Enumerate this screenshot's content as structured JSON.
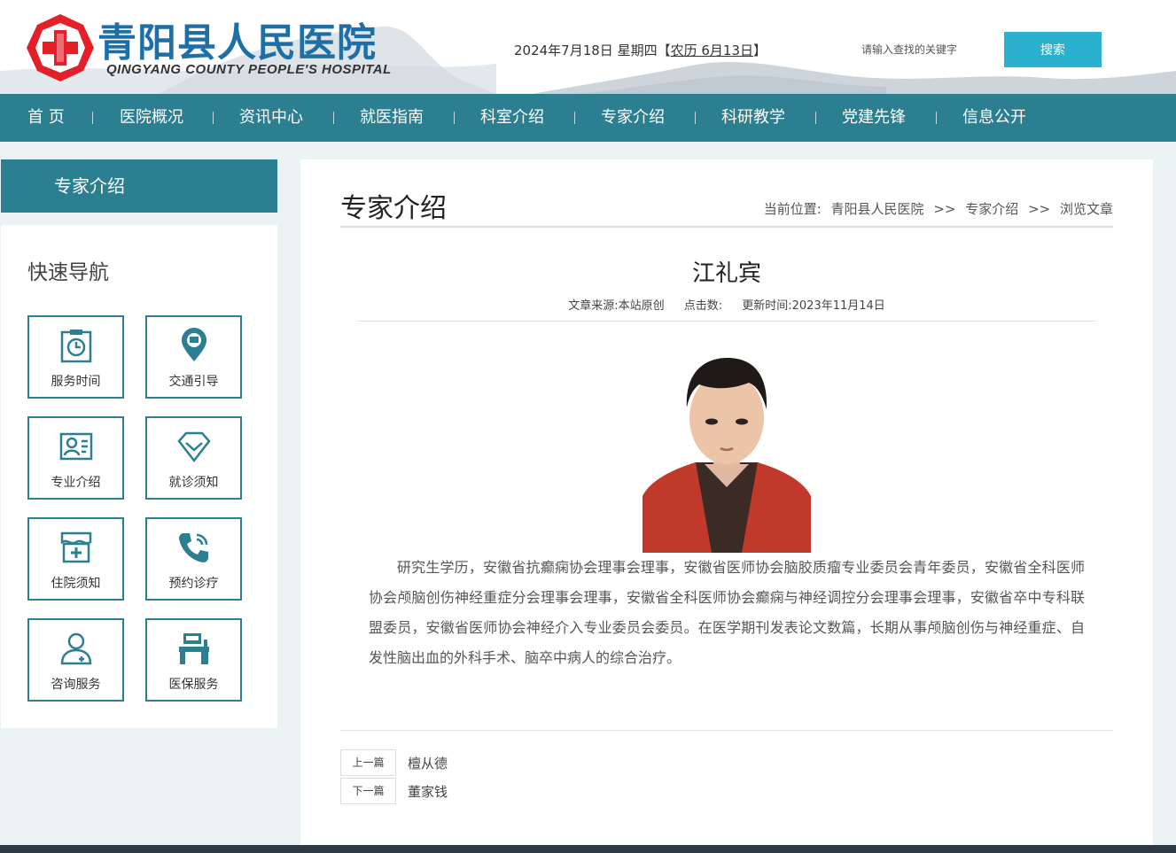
{
  "header": {
    "logo_cn": "青阳县人民医院",
    "logo_en": "QINGYANG COUNTY PEOPLE'S HOSPITAL",
    "date": "2024年7月18日 星期四",
    "lunar_open": "【",
    "lunar": "农历 6月13日",
    "lunar_close": "】",
    "search_placeholder": "请输入查找的关键字",
    "search_button": "搜索"
  },
  "nav": [
    {
      "label": "首 页"
    },
    {
      "label": "医院概况"
    },
    {
      "label": "资讯中心"
    },
    {
      "label": "就医指南"
    },
    {
      "label": "科室介绍"
    },
    {
      "label": "专家介绍"
    },
    {
      "label": "科研教学"
    },
    {
      "label": "党建先锋"
    },
    {
      "label": "信息公开"
    }
  ],
  "sidebar": {
    "title": "专家介绍",
    "quick_title": "快速导航",
    "items": [
      {
        "label": "服务时间",
        "icon": "clock-clipboard-icon"
      },
      {
        "label": "交通引导",
        "icon": "location-bus-icon"
      },
      {
        "label": "专业介绍",
        "icon": "profile-card-icon"
      },
      {
        "label": "就诊须知",
        "icon": "diamond-check-icon"
      },
      {
        "label": "住院须知",
        "icon": "hospital-bed-icon"
      },
      {
        "label": "预约诊疗",
        "icon": "phone-icon"
      },
      {
        "label": "咨询服务",
        "icon": "doctor-icon"
      },
      {
        "label": "医保服务",
        "icon": "desk-icon"
      }
    ]
  },
  "main": {
    "title": "专家介绍",
    "breadcrumb_label": "当前位置:",
    "breadcrumb": [
      "青阳县人民医院",
      ">>",
      "专家介绍",
      ">>",
      "浏览文章"
    ],
    "article_title": "江礼宾",
    "meta": {
      "source": "文章来源:本站原创",
      "clicks": "点击数:",
      "updated": "更新时间:2023年11月14日"
    },
    "body": "研究生学历，安徽省抗癫痫协会理事会理事，安徽省医师协会脑胶质瘤专业委员会青年委员，安徽省全科医师协会颅脑创伤神经重症分会理事会理事，安徽省全科医师协会癫痫与神经调控分会理事会理事，安徽省卒中专科联盟委员，安徽省医师协会神经介入专业委员会委员。在医学期刊发表论文数篇，长期从事颅脑创伤与神经重症、自发性脑出血的外科手术、脑卒中病人的综合治疗。",
    "prev_label": "上一篇",
    "prev_name": "檀从德",
    "next_label": "下一篇",
    "next_name": "董家钱"
  },
  "colors": {
    "teal": "#2b7f90",
    "search_blue": "#2bb1cf",
    "logo_red": "#e32028",
    "logo_blue": "#1d6fa8"
  }
}
